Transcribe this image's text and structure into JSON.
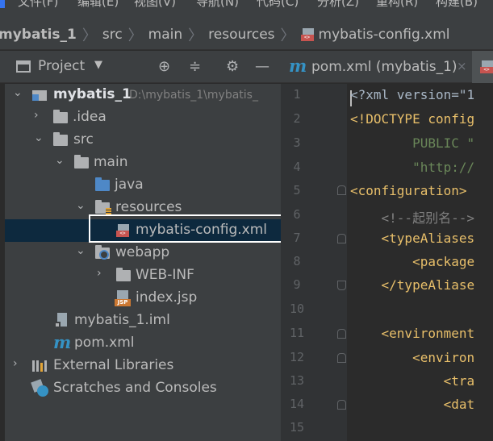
{
  "menubar": {
    "items": [
      "文件(F)",
      "编辑(E)",
      "视图(V)",
      "导航(N)",
      "代码(C)",
      "分析(Z)",
      "重构(R)",
      "构建(B)"
    ]
  },
  "breadcrumb": {
    "items": [
      "mybatis_1",
      "src",
      "main",
      "resources",
      "mybatis-config.xml"
    ]
  },
  "project_panel": {
    "title": "Project",
    "dropdown_icon": "triangle-down",
    "header_icons": [
      "crosshair-icon",
      "collapse-all-icon",
      "gear-icon",
      "minimize-icon"
    ]
  },
  "tree": [
    {
      "label": "mybatis_1",
      "path": "D:\\mybatis_1\\mybatis_",
      "icon": "module-icon",
      "expanded": true
    },
    {
      "label": ".idea",
      "icon": "folder-icon",
      "expanded": false
    },
    {
      "label": "src",
      "icon": "folder-icon",
      "expanded": true
    },
    {
      "label": "main",
      "icon": "folder-icon",
      "expanded": true
    },
    {
      "label": "java",
      "icon": "source-folder-icon"
    },
    {
      "label": "resources",
      "icon": "resources-folder-icon",
      "expanded": true
    },
    {
      "label": "mybatis-config.xml",
      "icon": "xml-file-icon",
      "selected": true
    },
    {
      "label": "webapp",
      "icon": "web-folder-icon",
      "expanded": true
    },
    {
      "label": "WEB-INF",
      "icon": "folder-icon",
      "expanded": false
    },
    {
      "label": "index.jsp",
      "icon": "jsp-file-icon"
    },
    {
      "label": "mybatis_1.iml",
      "icon": "iml-file-icon"
    },
    {
      "label": "pom.xml",
      "icon": "maven-icon"
    },
    {
      "label": "External Libraries",
      "icon": "libraries-icon",
      "expanded": false
    },
    {
      "label": "Scratches and Consoles",
      "icon": "scratches-icon"
    }
  ],
  "tabs": [
    {
      "label": "pom.xml (mybatis_1)",
      "icon": "maven-icon",
      "close": "×"
    }
  ],
  "editor": {
    "line_numbers": [
      "1",
      "2",
      "3",
      "4",
      "5",
      "6",
      "7",
      "8",
      "9",
      "10",
      "11",
      "12",
      "13",
      "14",
      "15"
    ],
    "lines": [
      "<?xml version=\"1",
      "<!DOCTYPE config",
      "        PUBLIC \"",
      "        \"http://",
      "<configuration>",
      "    <!--起别名-->",
      "    <typeAliases",
      "        <package",
      "    </typeAliase",
      "",
      "    <environment",
      "        <environ",
      "            <tra",
      "            <dat",
      ""
    ]
  },
  "colors": {
    "panel_bg": "#3c3f41",
    "editor_bg": "#2b2b2b",
    "selection": "#0d293e",
    "xml_tag": "#e8bf6a",
    "string": "#6a8759",
    "comment": "#808080"
  }
}
